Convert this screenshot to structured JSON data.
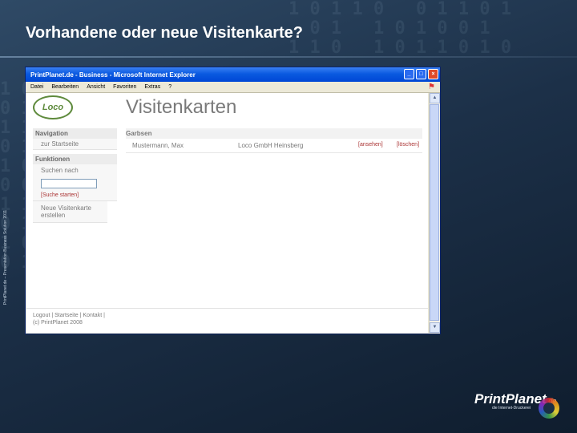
{
  "slide": {
    "title": "Vorhandene oder neue Visitenkarte?",
    "side_text": "PrintPlanet.de – Presentation Business Solution 2011"
  },
  "browser": {
    "title": "PrintPlanet.de - Business - Microsoft Internet Explorer",
    "menu": [
      "Datei",
      "Bearbeiten",
      "Ansicht",
      "Favoriten",
      "Extras",
      "?"
    ],
    "window_buttons": {
      "minimize": "_",
      "maximize": "□",
      "close": "×"
    }
  },
  "page": {
    "logo_text": "Loco",
    "heading": "Visitenkarten",
    "sidebar": {
      "navigation_head": "Navigation",
      "navigation_item": "zur Startseite",
      "functions_head": "Funktionen",
      "search_label": "Suchen nach",
      "search_value": "",
      "search_link": "[Suche starten]",
      "new_card_link": "Neue Visitenkarte erstellen"
    },
    "content": {
      "group_head": "Garbsen",
      "rows": [
        {
          "name": "Mustermann, Max",
          "company": "Loco GmbH Heinsberg",
          "action1": "[ansehen]",
          "action2": "[löschen]"
        }
      ]
    },
    "footer": {
      "links": "Logout | Startseite | Kontakt |",
      "copyright": "(c) PrintPlanet 2008"
    }
  },
  "brand": {
    "name": "PrintPlanet",
    "tld": ".de",
    "tagline": "die Internet-Druckerei"
  },
  "colors": {
    "background": "#1c3048",
    "titlebar": "#0a5ae0",
    "link_red": "#a33",
    "logo_green": "#5e8a3c"
  }
}
